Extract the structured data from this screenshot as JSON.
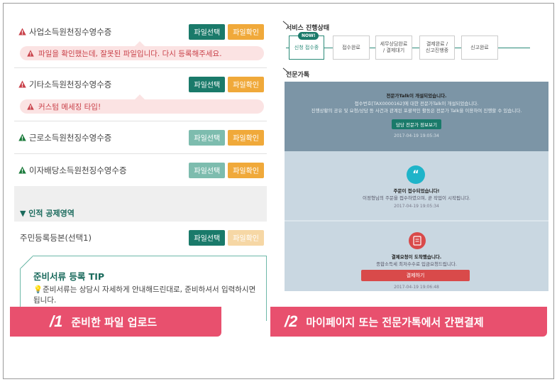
{
  "left": {
    "buttons": {
      "select": "파일선택",
      "confirm": "파일확인"
    },
    "docs": [
      {
        "title": "사업소득원천징수영수증",
        "warn": true
      },
      {
        "title": "기타소득원천징수영수증",
        "warn": true
      },
      {
        "title": "근로소득원천징수영수증",
        "warn": false
      },
      {
        "title": "이자배당소득원천징수영수증",
        "warn": false
      }
    ],
    "errors": [
      "파일을 확인했는데, 잘못된 파일입니다. 다시 등록해주세요.",
      "커스텀 메세징 타입!"
    ],
    "section_title": "▼ 인적 공제영역",
    "resident_doc": "주민등록등본(선택1)",
    "tip": {
      "title": "준비서류 등록 TIP",
      "body": "준비서류는 상담시 자세하게 안내해드린대로, 준비하셔서 입력하시면 됩니다."
    }
  },
  "right": {
    "status_label": "서비스 진행상태",
    "now_badge": "NOW!",
    "steps": [
      "신청 접수중",
      "접수완료",
      "세무상담완료\n/ 결제대기",
      "결제완료 /\n신고진행중",
      "신고완료"
    ],
    "chat_label": "전문가톡",
    "chat": {
      "opened_title": "전문가Talk이 개설되었습니다.",
      "opened_line1": "접수번호[TAX0000162]에 대한 전문가Talk이 개설되었습니다.",
      "opened_line2": "진행상황의 공유 및 요청/상담 등 사건과 관계된 포괄적인 활동은 전문가 Talk을 이용하여 진행할 수 있습니다.",
      "expert_button": "담당 전문가 정보보기",
      "date1": "2017-04-19 19:05:34",
      "order_title": "주문이 접수되었습니다!",
      "order_line": "이정형님의 주문을 접수하였으며, 곧 작업이 시작됩니다.",
      "date2": "2017-04-19 19:05:34",
      "pay_title": "결제요청이 도착했습니다.",
      "pay_line": "종합소득세 최저수수료 입금요청드립니다.",
      "pay_button": "결제하기",
      "date3": "2017-04-19 19:06:48"
    }
  },
  "captions": [
    {
      "num": "/1",
      "text": "준비한 파일 업로드"
    },
    {
      "num": "/2",
      "text": "마이페이지 또는 전문가톡에서 간편결제"
    }
  ],
  "colors": {
    "teal": "#1a7a6a",
    "orange": "#f0a93a",
    "pink": "#e8506e",
    "error_bg": "#fbe3e3"
  }
}
